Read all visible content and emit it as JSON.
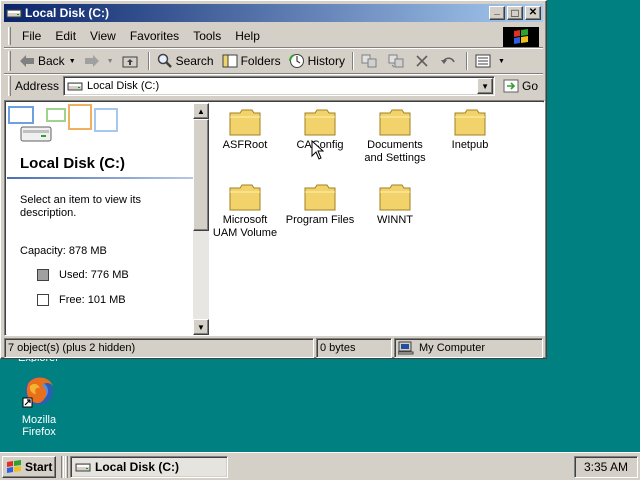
{
  "desktop": {
    "partial_label": "Explorer",
    "firefox_label": "Mozilla Firefox"
  },
  "window": {
    "title": "Local Disk (C:)",
    "buttons": {
      "minimize": "_",
      "maximize": "□",
      "close": "✕"
    }
  },
  "menu": {
    "items": [
      "File",
      "Edit",
      "View",
      "Favorites",
      "Tools",
      "Help"
    ]
  },
  "toolbar": {
    "back": "Back",
    "search": "Search",
    "folders": "Folders",
    "history": "History"
  },
  "address": {
    "label": "Address",
    "value": "Local Disk (C:)",
    "go": "Go"
  },
  "leftpane": {
    "title": "Local Disk (C:)",
    "description": "Select an item to view its description.",
    "capacity": "Capacity: 878 MB",
    "used": "Used: 776 MB",
    "free": "Free: 101 MB",
    "colors": {
      "used": "#a0a0a0",
      "free": "#ffffff"
    }
  },
  "folders": [
    {
      "label": "ASFRoot"
    },
    {
      "label": "CAConfig"
    },
    {
      "label": "Documents and Settings"
    },
    {
      "label": "Inetpub"
    },
    {
      "label": "Microsoft UAM Volume"
    },
    {
      "label": "Program Files"
    },
    {
      "label": "WINNT"
    }
  ],
  "status": {
    "objects": "7 object(s) (plus 2 hidden)",
    "size": "0 bytes",
    "zone": "My Computer"
  },
  "taskbar": {
    "start": "Start",
    "task": "Local Disk (C:)",
    "clock": "3:35 AM"
  },
  "colors": {
    "desktop": "#008080",
    "title_start": "#0a246a",
    "title_end": "#a6caf0",
    "chrome": "#d4d0c8",
    "folder": "#f2d36b"
  }
}
